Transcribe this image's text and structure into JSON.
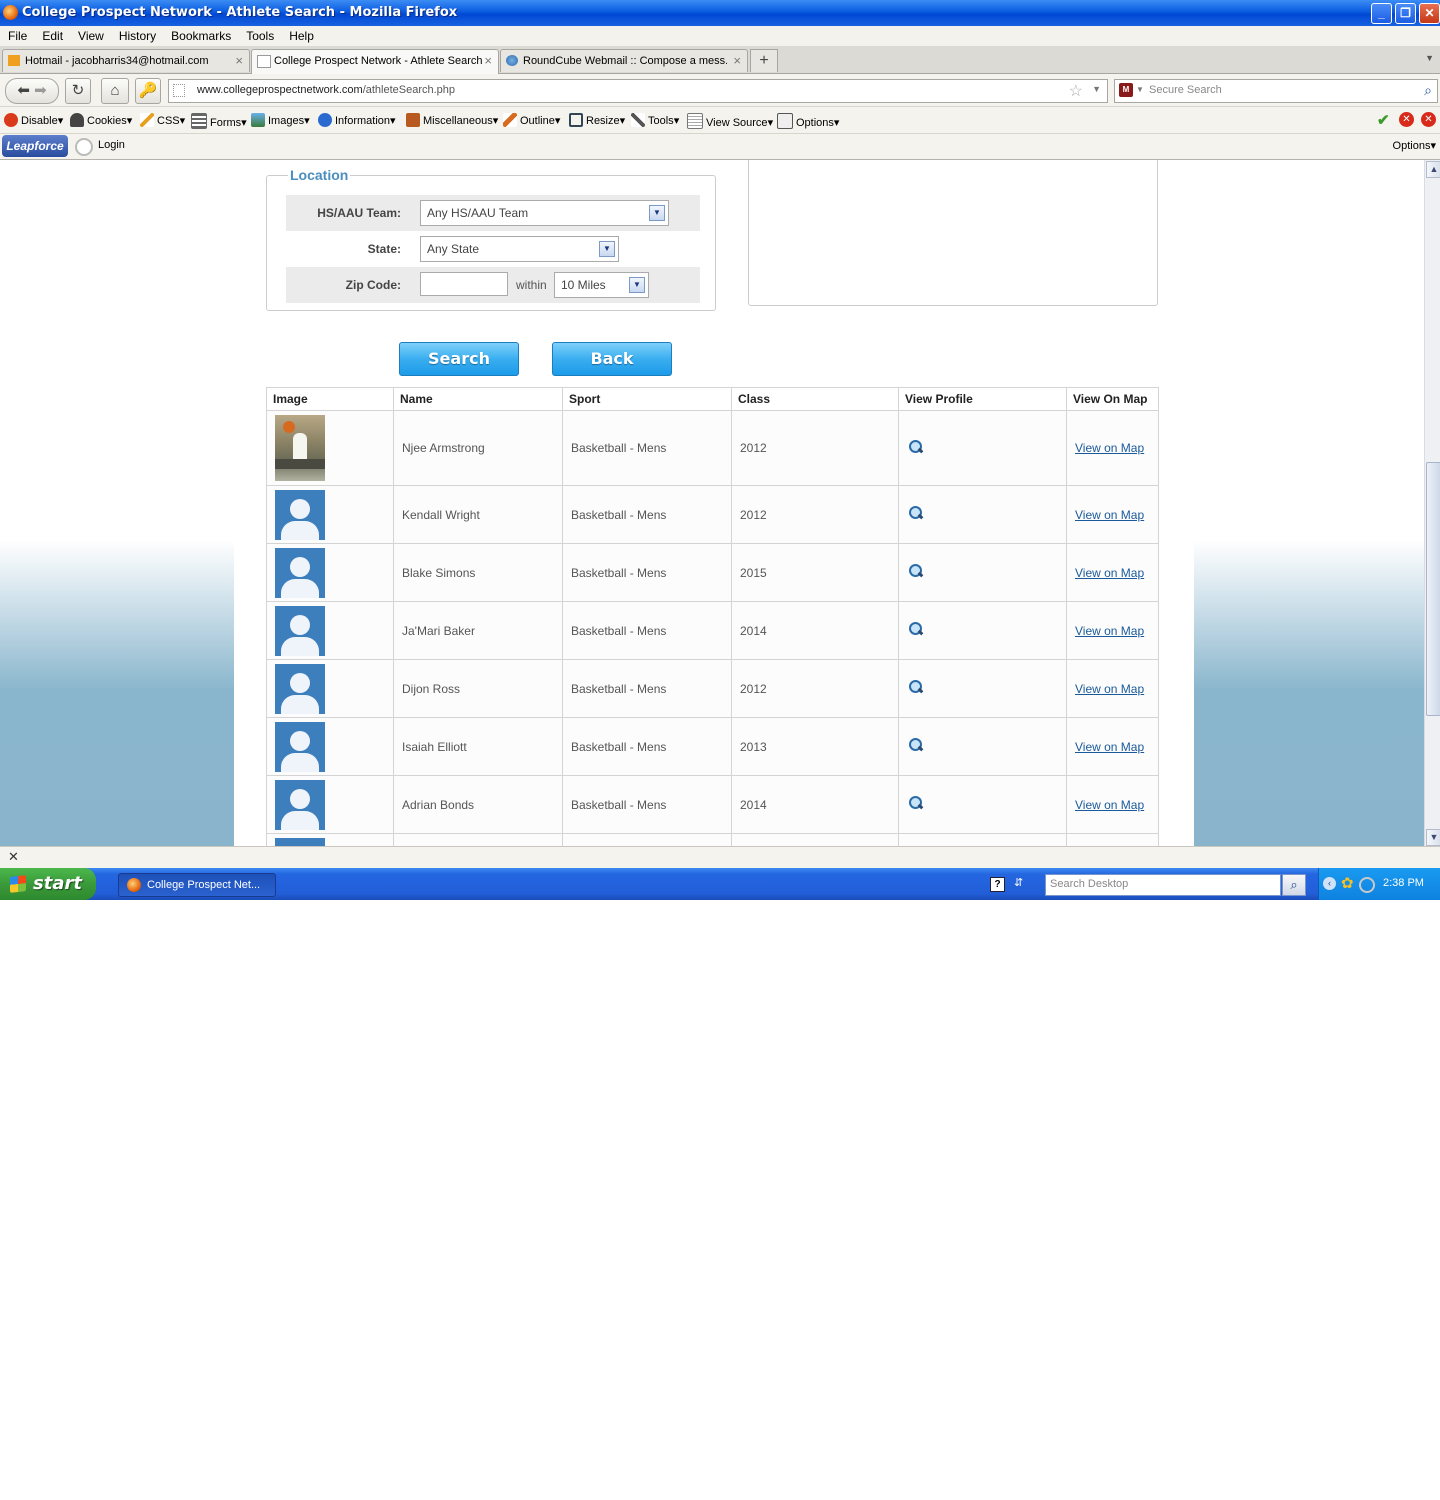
{
  "window": {
    "title": "College Prospect Network - Athlete Search - Mozilla Firefox"
  },
  "menu": [
    "File",
    "Edit",
    "View",
    "History",
    "Bookmarks",
    "Tools",
    "Help"
  ],
  "tabs": [
    {
      "label": "Hotmail - jacobharris34@hotmail.com"
    },
    {
      "label": "College Prospect Network - Athlete Search"
    },
    {
      "label": "RoundCube Webmail :: Compose a mess..."
    }
  ],
  "nav": {
    "url_domain": "www.collegeprospectnetwork.com",
    "url_path": "/athleteSearch.php",
    "search_placeholder": "Secure Search"
  },
  "webdev_toolbar": {
    "items": [
      "Disable",
      "Cookies",
      "CSS",
      "Forms",
      "Images",
      "Information",
      "Miscellaneous",
      "Outline",
      "Resize",
      "Tools",
      "View Source",
      "Options"
    ]
  },
  "leapforce": {
    "logo": "Leapforce",
    "login": "Login",
    "options": "Options"
  },
  "location": {
    "legend": "Location",
    "team_label": "HS/AAU Team:",
    "team_value": "Any HS/AAU Team",
    "state_label": "State:",
    "state_value": "Any State",
    "zip_label": "Zip Code:",
    "zip_value": "",
    "within_label": "within",
    "radius_value": "10 Miles"
  },
  "buttons": {
    "search": "Search",
    "back": "Back"
  },
  "results": {
    "headers": [
      "Image",
      "Name",
      "Sport",
      "Class",
      "View Profile",
      "View On Map"
    ],
    "rows": [
      {
        "name": "Njee Armstrong",
        "sport": "Basketball - Mens",
        "class": "2012",
        "map": "View on Map"
      },
      {
        "name": "Kendall Wright",
        "sport": "Basketball - Mens",
        "class": "2012",
        "map": "View on Map"
      },
      {
        "name": "Blake Simons",
        "sport": "Basketball - Mens",
        "class": "2015",
        "map": "View on Map"
      },
      {
        "name": "Ja'Mari Baker",
        "sport": "Basketball - Mens",
        "class": "2014",
        "map": "View on Map"
      },
      {
        "name": "Dijon Ross",
        "sport": "Basketball - Mens",
        "class": "2012",
        "map": "View on Map"
      },
      {
        "name": "Isaiah Elliott",
        "sport": "Basketball - Mens",
        "class": "2013",
        "map": "View on Map"
      },
      {
        "name": "Adrian Bonds",
        "sport": "Basketball - Mens",
        "class": "2014",
        "map": "View on Map"
      }
    ]
  },
  "taskbar": {
    "start": "start",
    "task_label": "College Prospect Net...",
    "desktop_search_placeholder": "Search Desktop",
    "clock": "2:38 PM"
  },
  "colors": {
    "accent": "#4a8ec0",
    "button": "#3aaef0",
    "link": "#1a5a9a"
  }
}
